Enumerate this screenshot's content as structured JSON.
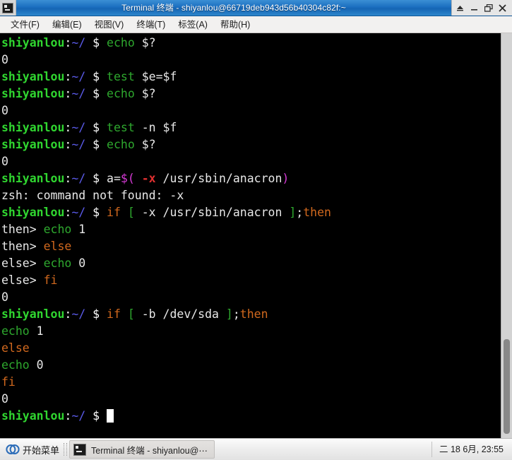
{
  "window": {
    "title": "Terminal 终端 - shiyanlou@66719deb943d56b40304c82f:~",
    "app_icon": "terminal-icon",
    "controls": [
      {
        "name": "shade-button",
        "glyph": "shade-icon"
      },
      {
        "name": "minimize-button",
        "glyph": "minimize-icon"
      },
      {
        "name": "maximize-button",
        "glyph": "maximize-icon"
      },
      {
        "name": "close-button",
        "glyph": "close-icon"
      }
    ]
  },
  "menubar": {
    "items": [
      {
        "label": "文件(F)",
        "name": "menu-file"
      },
      {
        "label": "编辑(E)",
        "name": "menu-edit"
      },
      {
        "label": "视图(V)",
        "name": "menu-view"
      },
      {
        "label": "终端(T)",
        "name": "menu-terminal"
      },
      {
        "label": "标签(A)",
        "name": "menu-tabs"
      },
      {
        "label": "帮助(H)",
        "name": "menu-help"
      }
    ]
  },
  "terminal": {
    "prompt": {
      "user": "shiyanlou",
      "colon": ":",
      "path": "~/",
      "symbol": "$"
    },
    "colors": {
      "background": "#000000",
      "foreground": "#e8e8e8",
      "host_green": "#30d630",
      "path_blue": "#5a5ae8",
      "command_green": "#2ea82e",
      "keyword_orange": "#d2691e",
      "bracket_green": "#2ea82e",
      "substitution_magenta": "#d63ad6",
      "option_red": "#e03030",
      "cursor": "#ffffff"
    },
    "lines": [
      {
        "type": "prompt",
        "command": "echo $?",
        "cmd_word": "echo",
        "args": " $?"
      },
      {
        "type": "output",
        "text": "0"
      },
      {
        "type": "prompt",
        "command": "test $e=$f",
        "cmd_word": "test",
        "args": " $e=$f"
      },
      {
        "type": "prompt",
        "command": "echo $?",
        "cmd_word": "echo",
        "args": " $?"
      },
      {
        "type": "output",
        "text": "0"
      },
      {
        "type": "prompt",
        "command": "test -n $f",
        "cmd_word": "test",
        "args": " -n $f"
      },
      {
        "type": "prompt",
        "command": "echo $?",
        "cmd_word": "echo",
        "args": " $?"
      },
      {
        "type": "output",
        "text": "0"
      },
      {
        "type": "prompt-subst",
        "command": "a=$( -x /usr/sbin/anacron)"
      },
      {
        "type": "output",
        "text": "zsh: command not found: -x"
      },
      {
        "type": "prompt-if",
        "command": "if [ -x /usr/sbin/anacron ];then"
      },
      {
        "type": "cont-then",
        "prefix": "then> ",
        "command": "echo 1",
        "cmd_word": "echo",
        "args": " 1"
      },
      {
        "type": "cont-then-kw",
        "prefix": "then> ",
        "command": "else"
      },
      {
        "type": "cont-else",
        "prefix": "else> ",
        "command": "echo 0",
        "cmd_word": "echo",
        "args": " 0"
      },
      {
        "type": "cont-else-kw",
        "prefix": "else> ",
        "command": "fi"
      },
      {
        "type": "output",
        "text": "0"
      },
      {
        "type": "prompt-if",
        "command": "if [ -b /dev/sda ];then"
      },
      {
        "type": "plain-cmd",
        "cmd_word": "echo",
        "args": " 1"
      },
      {
        "type": "plain-kw",
        "command": "else"
      },
      {
        "type": "plain-cmd",
        "cmd_word": "echo",
        "args": " 0"
      },
      {
        "type": "plain-kw",
        "command": "fi"
      },
      {
        "type": "output",
        "text": "0"
      },
      {
        "type": "prompt-cursor",
        "command": ""
      }
    ],
    "scrollbar": {
      "name": "terminal-scrollbar",
      "thumb_position": "near-bottom"
    }
  },
  "taskbar": {
    "start_label": "开始菜单",
    "start_icon": "start-menu-icon",
    "task_icon": "terminal-icon",
    "task_label": "Terminal 终端 - shiyanlou@⋯",
    "clock": "二 18 6月, 23:55"
  }
}
